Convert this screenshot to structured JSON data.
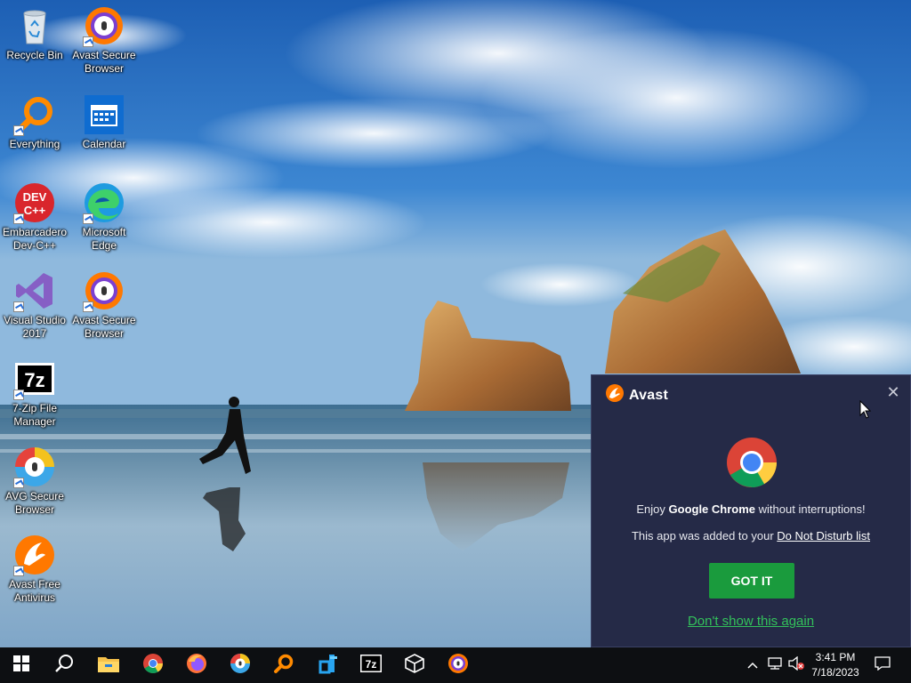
{
  "desktop": {
    "icons": [
      {
        "label": "Recycle Bin",
        "icon": "recycle-bin-icon"
      },
      {
        "label": "Avast Secure\nBrowser",
        "icon": "avast-secure-browser-icon"
      },
      {
        "label": "Everything",
        "icon": "everything-search-icon"
      },
      {
        "label": "Calendar",
        "icon": "calendar-icon"
      },
      {
        "label": "Embarcadero\nDev-C++",
        "icon": "devcpp-icon"
      },
      {
        "label": "Microsoft\nEdge",
        "icon": "edge-icon"
      },
      {
        "label": "Visual Studio\n2017",
        "icon": "visual-studio-icon"
      },
      {
        "label": "Avast Secure\nBrowser",
        "icon": "avast-secure-browser-icon"
      },
      {
        "label": "7-Zip File\nManager",
        "icon": "7zip-icon"
      },
      {
        "label": "AVG Secure\nBrowser",
        "icon": "avg-secure-browser-icon"
      },
      {
        "label": "Avast Free\nAntivirus",
        "icon": "avast-antivirus-icon"
      }
    ]
  },
  "popup": {
    "brand": "Avast",
    "line1_prefix": "Enjoy ",
    "line1_app": "Google Chrome",
    "line1_suffix": " without interruptions!",
    "line2_prefix": "This app was added to your ",
    "line2_link": "Do Not Disturb list",
    "primary_button": "GOT IT",
    "dismiss_link": "Don't show this again",
    "close_glyph": "✕"
  },
  "taskbar": {
    "apps": [
      "start-icon",
      "search-icon",
      "file-explorer-icon",
      "chrome-icon",
      "firefox-icon",
      "avg-secure-browser-icon",
      "everything-search-icon",
      "devtool-icon",
      "7zip-icon",
      "3d-box-icon",
      "avast-secure-browser-icon"
    ],
    "clock": {
      "time": "3:41 PM",
      "date": "7/18/2023"
    }
  },
  "colors": {
    "popup_bg": "#252a47",
    "button_green": "#1a9b3d",
    "link_green": "#33c15b",
    "avast_orange": "#ff7800",
    "taskbar": "#0d0f12"
  }
}
